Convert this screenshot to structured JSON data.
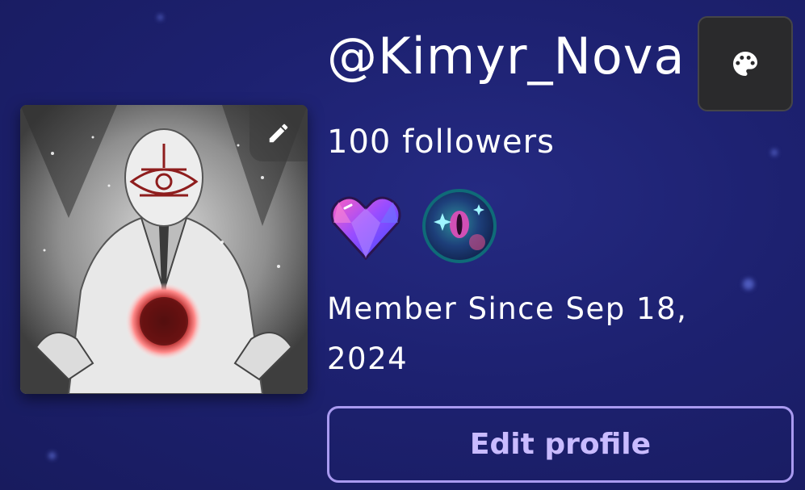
{
  "profile": {
    "username": "@Kimyr_Nova",
    "followers_text": "100 followers",
    "member_since_line1": "Member Since Sep 18,",
    "member_since_line2": "2024",
    "edit_profile_label": "Edit profile"
  },
  "icons": {
    "edit_avatar": "pencil-icon",
    "theme": "palette-icon",
    "badge_1": "crystal-heart-badge-icon",
    "badge_2": "cosmic-eye-badge-icon"
  },
  "colors": {
    "background": "#1d2170",
    "accent": "#a99af0",
    "button_text": "#c9bbff",
    "theme_button_bg": "#2a2a2c",
    "text": "#ffffff"
  }
}
